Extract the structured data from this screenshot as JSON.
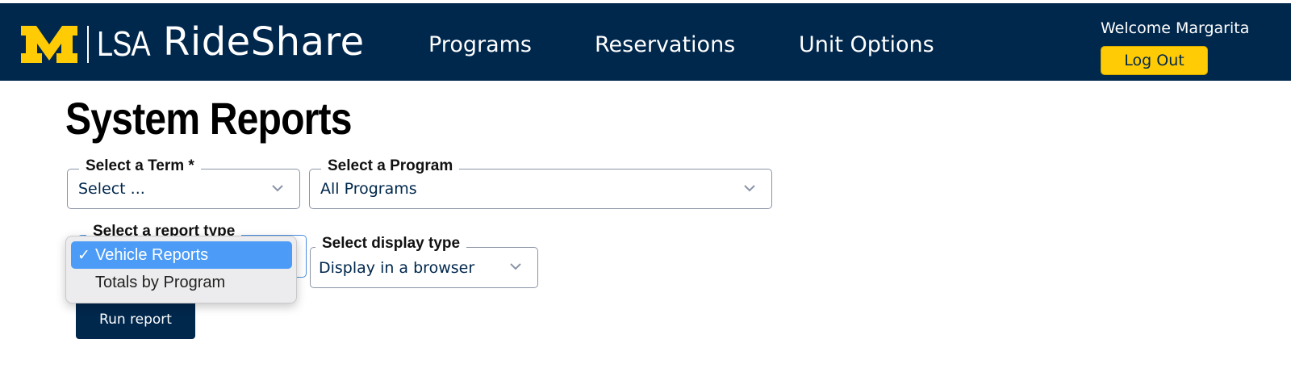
{
  "header": {
    "logo_text": "LSA",
    "app_title": "RideShare",
    "nav": [
      "Programs",
      "Reservations",
      "Unit Options"
    ],
    "welcome": "Welcome Margarita",
    "logout_label": "Log Out"
  },
  "page": {
    "title": "System Reports"
  },
  "form": {
    "term": {
      "label": "Select a Term *",
      "value": "Select ..."
    },
    "program": {
      "label": "Select a Program",
      "value": "All Programs"
    },
    "report_type": {
      "label": "Select a report type",
      "options": [
        "Vehicle Reports",
        "Totals by Program"
      ],
      "selected": "Vehicle Reports",
      "check_mark": "✓"
    },
    "display_type": {
      "label": "Select display type",
      "value": "Display in a browser"
    },
    "run_label": "Run report"
  },
  "colors": {
    "navy": "#00274c",
    "maize": "#ffcb05",
    "selected_option": "#4c9cf7"
  },
  "icons": [
    "block-m-logo",
    "chevron-down-icon",
    "checkmark-icon"
  ]
}
